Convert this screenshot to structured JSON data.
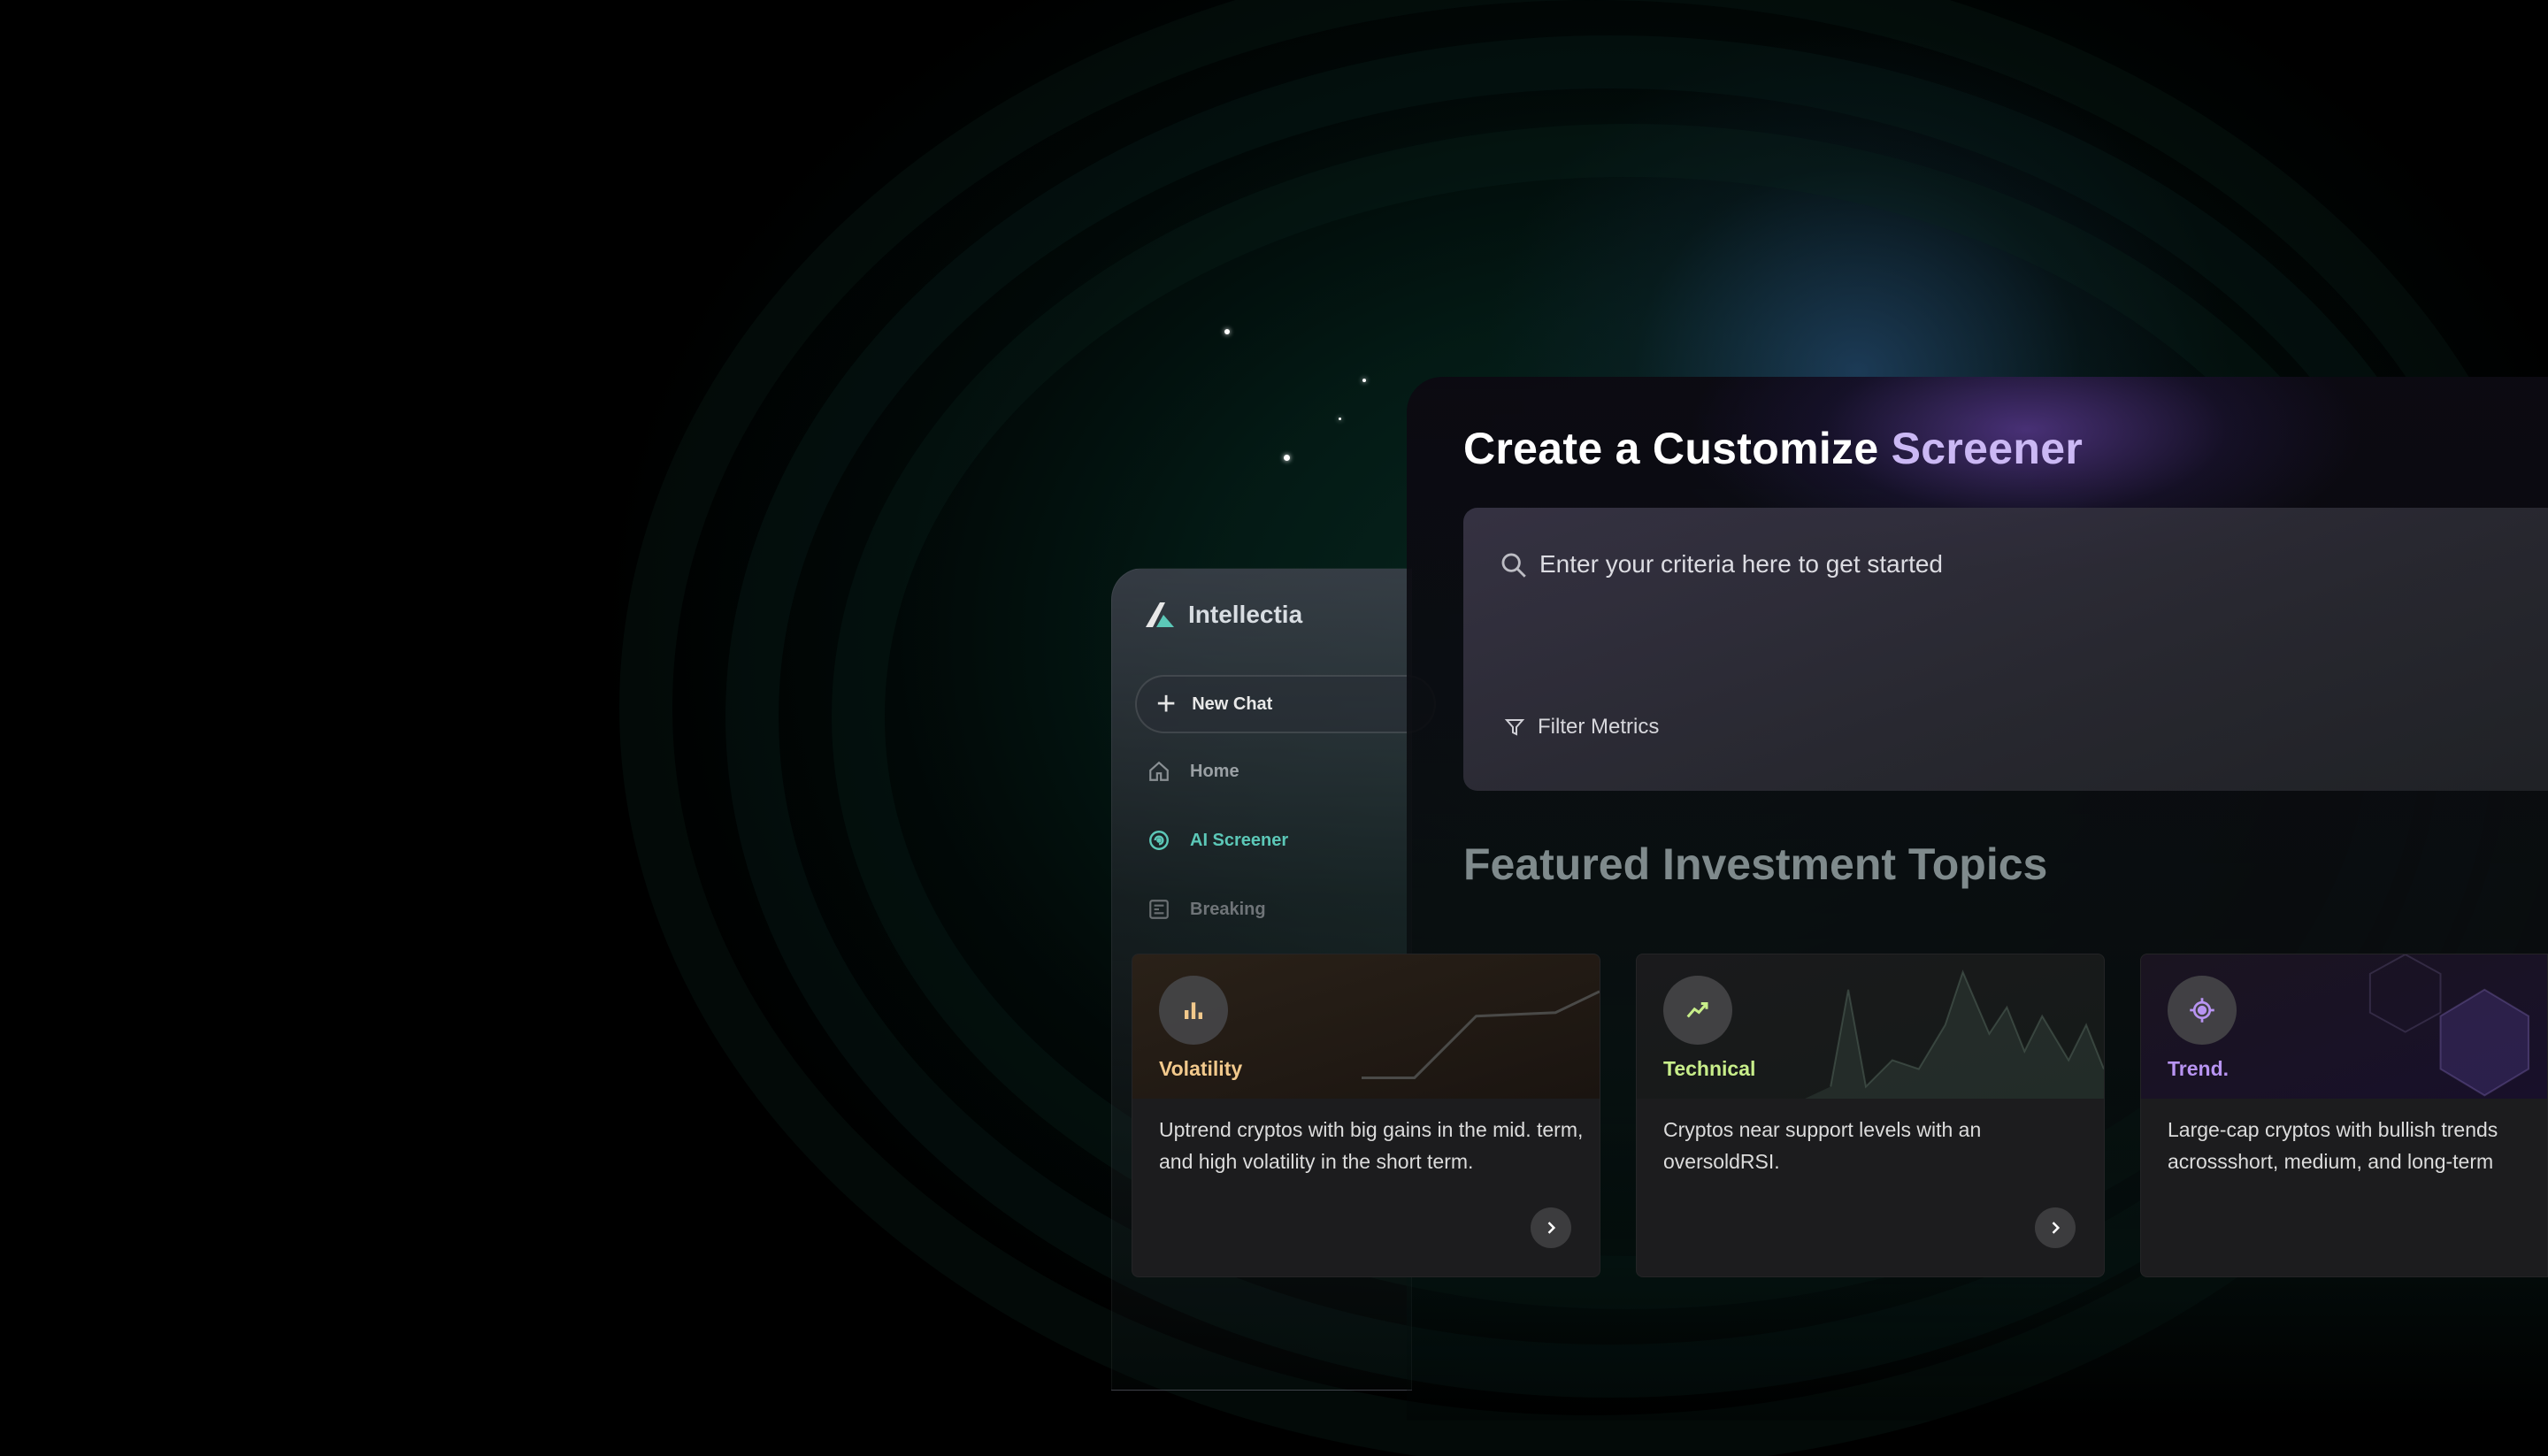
{
  "brand": {
    "name": "Intellectia",
    "accent": "#5cc8b8"
  },
  "sidebar": {
    "new_chat": "New Chat",
    "items": [
      {
        "label": "Home",
        "icon": "home-icon",
        "active": false
      },
      {
        "label": "AI Screener",
        "icon": "screener-icon",
        "active": true
      },
      {
        "label": "Breaking",
        "icon": "news-icon",
        "active": false
      }
    ]
  },
  "main": {
    "title_part1": "Create a Customize",
    "title_part2": "Screener",
    "search": {
      "placeholder": "Enter your criteria here to get started",
      "value": ""
    },
    "filter_label": "Filter Metrics",
    "section_title": "Featured Investment Topics"
  },
  "cards": [
    {
      "title": "Volatility",
      "title_color": "#f2c98c",
      "icon": "bar-chart-icon",
      "description": "Uptrend cryptos with big gains in the mid. term, and high volatility in the short term."
    },
    {
      "title": "Technical",
      "title_color": "#c8ee8a",
      "icon": "trend-icon",
      "description": "Cryptos near support levels with an oversoldRSI."
    },
    {
      "title": "Trend.",
      "title_color": "#b894f2",
      "icon": "target-icon",
      "description": "Large-cap cryptos with bullish trends acrossshort, medium, and long-term"
    }
  ]
}
